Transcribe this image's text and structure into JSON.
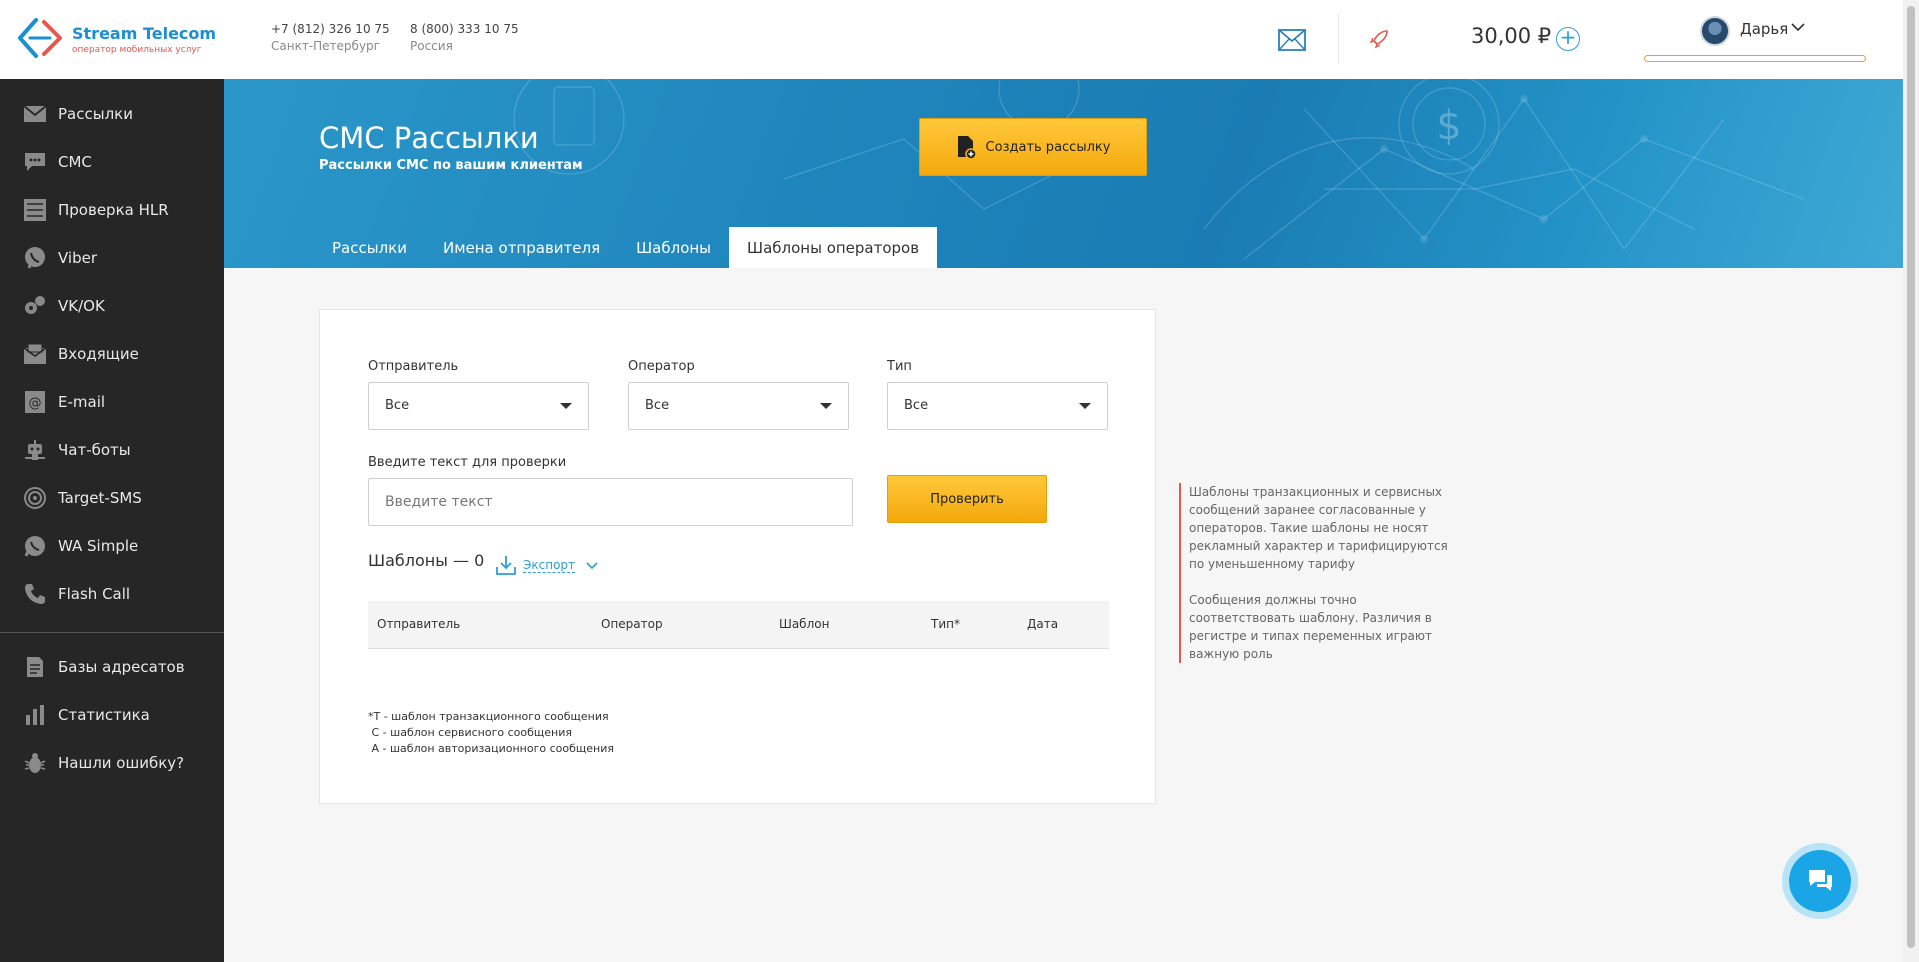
{
  "header": {
    "logo_name": "Stream Telecom",
    "logo_tagline": "оператор мобильных услуг",
    "phones": [
      {
        "number": "+7 (812) 326 10 75",
        "city": "Санкт-Петербург"
      },
      {
        "number": "8 (800) 333 10 75",
        "city": "Россия"
      }
    ],
    "balance": "30,00 ₽",
    "add_balance_symbol": "+",
    "user_name": "Дарья"
  },
  "sidebar": {
    "items": [
      {
        "label": "Рассылки",
        "icon": "mail-broadcast-icon"
      },
      {
        "label": "СМС",
        "icon": "chat-bubble-icon"
      },
      {
        "label": "Проверка HLR",
        "icon": "checklist-icon"
      },
      {
        "label": "Viber",
        "icon": "viber-icon"
      },
      {
        "label": "VK/OK",
        "icon": "vk-ok-icon"
      },
      {
        "label": "Входящие",
        "icon": "inbox-icon"
      },
      {
        "label": "E-mail",
        "icon": "email-icon"
      },
      {
        "label": "Чат-боты",
        "icon": "robot-icon"
      },
      {
        "label": "Target-SMS",
        "icon": "target-icon"
      },
      {
        "label": "WA Simple",
        "icon": "whatsapp-icon"
      },
      {
        "label": "Flash Call",
        "icon": "phone-icon"
      }
    ],
    "items_bottom": [
      {
        "label": "Базы адресатов",
        "icon": "contacts-database-icon"
      },
      {
        "label": "Статистика",
        "icon": "bar-chart-icon"
      },
      {
        "label": "Нашли ошибку?",
        "icon": "bug-icon"
      }
    ]
  },
  "banner": {
    "title": "СМС Рассылки",
    "subtitle": "Рассылки СМС по вашим клиентам",
    "create_button": "Создать рассылку",
    "tabs": [
      {
        "label": "Рассылки",
        "active": false
      },
      {
        "label": "Имена отправителя",
        "active": false
      },
      {
        "label": "Шаблоны",
        "active": false
      },
      {
        "label": "Шаблоны операторов",
        "active": true
      }
    ]
  },
  "filters": {
    "sender_label": "Отправитель",
    "sender_value": "Все",
    "operator_label": "Оператор",
    "operator_value": "Все",
    "type_label": "Тип",
    "type_value": "Все",
    "text_label": "Введите текст для проверки",
    "text_placeholder": "Введите текст",
    "check_button": "Проверить"
  },
  "templates": {
    "count_label": "Шаблоны — 0",
    "export_label": "Экспорт",
    "columns": [
      "Отправитель",
      "Оператор",
      "Шаблон",
      "Тип*",
      "Дата"
    ],
    "rows": []
  },
  "legend": [
    "*Т - шаблон транзакционного сообщения",
    " С - шаблон сервисного сообщения",
    " А - шаблон авторизационного сообщения"
  ],
  "note": {
    "paragraph1": "Шаблоны транзакционных и сервисных сообщений заранее согласованные у операторов. Такие шаблоны не носят рекламный характер и тарифицируются по уменьшенному тарифу",
    "paragraph2": "Сообщения должны точно соответствовать шаблону. Различия в регистре и типах переменных играют важную роль"
  },
  "colors": {
    "accent_blue": "#2b9fd6",
    "accent_yellow": "#f4a90d",
    "sidebar_bg": "#262626",
    "brand_red": "#e4584e"
  }
}
